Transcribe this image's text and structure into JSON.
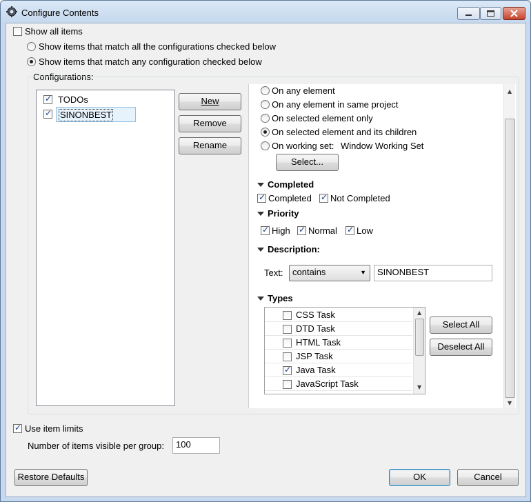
{
  "window": {
    "title": "Configure Contents"
  },
  "top": {
    "show_all_items": "Show all items",
    "radio_all": "Show items that match all the configurations checked below",
    "radio_any": "Show items that match any configuration checked below"
  },
  "configurations": {
    "label": "Configurations:",
    "items": [
      {
        "label": "TODOs",
        "checked": true
      },
      {
        "label": "SINONBEST",
        "checked": true
      }
    ],
    "buttons": {
      "new": "New",
      "remove": "Remove",
      "rename": "Rename"
    }
  },
  "scope": {
    "options": [
      {
        "label": "On any element",
        "checked": false
      },
      {
        "label": "On any element in same project",
        "checked": false
      },
      {
        "label": "On selected element only",
        "checked": false
      },
      {
        "label": "On selected element and its children",
        "checked": true
      },
      {
        "label": "On working set:",
        "checked": false
      }
    ],
    "working_set_value": "Window Working Set",
    "select_button": "Select..."
  },
  "completed": {
    "title": "Completed",
    "items": [
      "Completed",
      "Not Completed"
    ]
  },
  "priority": {
    "title": "Priority",
    "items": [
      "High",
      "Normal",
      "Low"
    ]
  },
  "description": {
    "title": "Description:",
    "text_label": "Text:",
    "operator": "contains",
    "value": "SINONBEST"
  },
  "types": {
    "title": "Types",
    "items": [
      {
        "label": "CSS Task",
        "checked": false
      },
      {
        "label": "DTD Task",
        "checked": false
      },
      {
        "label": "HTML Task",
        "checked": false
      },
      {
        "label": "JSP Task",
        "checked": false
      },
      {
        "label": "Java Task",
        "checked": true
      },
      {
        "label": "JavaScript Task",
        "checked": false
      }
    ],
    "select_all": "Select All",
    "deselect_all": "Deselect All"
  },
  "limits": {
    "use_limits": "Use item limits",
    "visible_label": "Number of items visible per group:",
    "visible_value": "100"
  },
  "footer": {
    "restore": "Restore Defaults",
    "ok": "OK",
    "cancel": "Cancel"
  }
}
